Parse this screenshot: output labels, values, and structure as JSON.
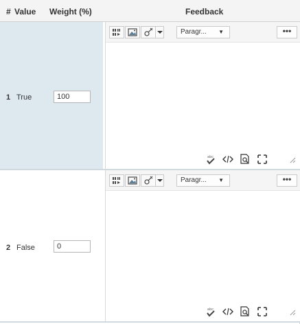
{
  "header": {
    "num_label": "#",
    "value_label": "Value",
    "weight_label": "Weight (%)",
    "feedback_label": "Feedback"
  },
  "rows": [
    {
      "num": "1",
      "value": "True",
      "weight": "100",
      "editor": {
        "format_label": "Paragr...",
        "more_label": "•••"
      }
    },
    {
      "num": "2",
      "value": "False",
      "weight": "0",
      "editor": {
        "format_label": "Paragr...",
        "more_label": "•••"
      }
    }
  ],
  "icons": {
    "toolbar": [
      "insert-media-icon",
      "image-icon",
      "equation-icon",
      "dropdown-arrow-icon"
    ],
    "footer": [
      "spellcheck-icon",
      "source-code-icon",
      "preview-icon",
      "fullscreen-icon",
      "resize-handle-icon"
    ]
  },
  "colors": {
    "selected_row": "#dde9ef",
    "header_bg": "#f4f4f4",
    "border": "#c9c9c9"
  }
}
